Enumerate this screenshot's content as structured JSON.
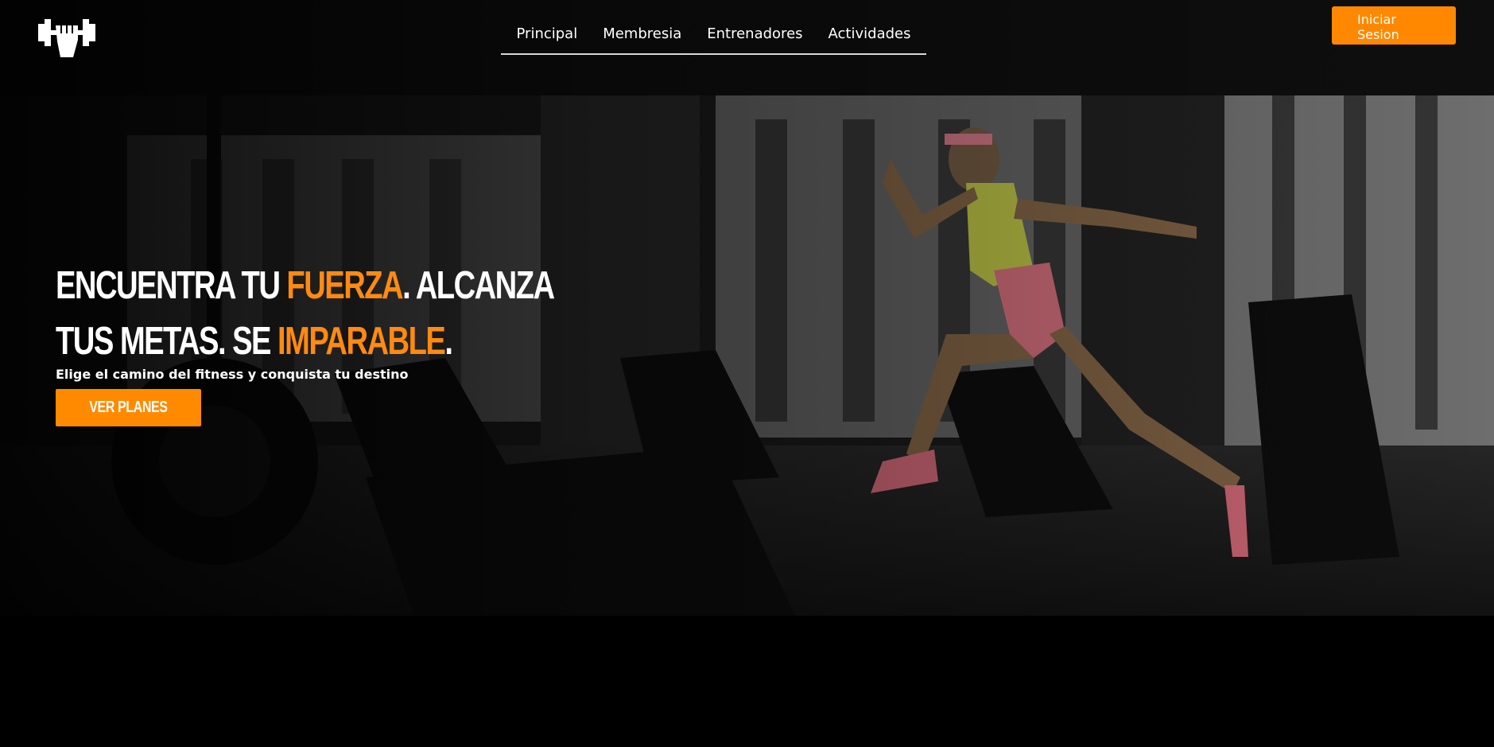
{
  "header": {
    "logo_icon": "dumbbell-fist-icon",
    "nav": [
      {
        "label": "Principal"
      },
      {
        "label": "Membresia"
      },
      {
        "label": "Entrenadores"
      },
      {
        "label": "Actividades"
      }
    ],
    "login": {
      "line1": "Iniciar",
      "line2": "Sesion"
    }
  },
  "hero": {
    "headline": {
      "part1": "ENCUENTRA TU ",
      "highlight1": "FUERZA",
      "part2": ". ALCANZA",
      "part3": "TUS METAS. SE ",
      "highlight2": "IMPARABLE",
      "part4": "."
    },
    "subtitle": "Elige el camino del fitness y conquista tu destino",
    "cta_label": "VER PLANES"
  },
  "colors": {
    "accent": "#ff8a00",
    "background": "#000000",
    "text": "#ffffff"
  }
}
